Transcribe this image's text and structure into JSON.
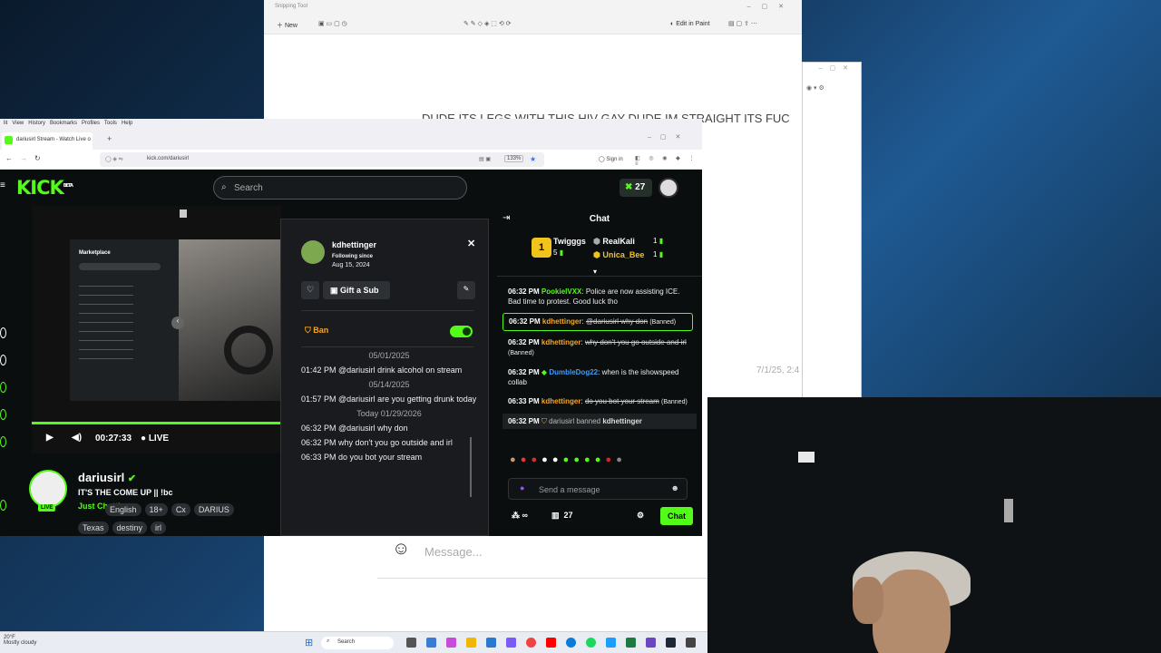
{
  "snipping": {
    "title": "Snipping Tool",
    "new_label": "New",
    "edit_in_paint": "Edit in Paint",
    "caption_text": "DUDE ITS LEGS WITH THIS HIV GAY DUDE IM STRAIGHT ITS FUC",
    "side_date": "7/1/25, 2:4"
  },
  "browser": {
    "menu": [
      "lit",
      "View",
      "History",
      "Bookmarks",
      "Profiles",
      "Tools",
      "Help"
    ],
    "tab_title": "dariusirl Stream - Watch Live o",
    "url": "kick.com/dariusirl",
    "zoom": "133%",
    "sign_in": "Sign in"
  },
  "kick": {
    "logo": "KICK",
    "logo_beta": "BETA",
    "search_placeholder": "Search",
    "kick_count": "27"
  },
  "player": {
    "time": "00:27:33",
    "live_label": "LIVE",
    "progress": 1.0
  },
  "streamer": {
    "name": "dariusirl",
    "live_badge": "LIVE",
    "title": "IT'S THE COME UP || !bc",
    "category": "Just Chatting",
    "tags_row1": [
      "English",
      "18+",
      "Cx",
      "DARIUS"
    ],
    "tags_row2": [
      "Texas",
      "destiny",
      "irl"
    ]
  },
  "user_card": {
    "username": "kdhettinger",
    "following_label": "Following since",
    "following_date": "Aug 15, 2024",
    "gift_sub": "Gift a Sub",
    "ban_label": "Ban",
    "ban_enabled": true,
    "history": [
      {
        "date": "05/01/2025",
        "messages": [
          "01:42 PM @dariusirl drink alcohol on stream"
        ]
      },
      {
        "date": "05/14/2025",
        "messages": [
          "01:57 PM @dariusirl are you getting drunk today"
        ]
      },
      {
        "date": "Today 01/29/2026",
        "messages": [
          "06:32 PM @dariusirl why don",
          "06:32 PM why don't you go outside and irl",
          "06:33 PM do you bot your stream"
        ]
      }
    ]
  },
  "chat": {
    "title": "Chat",
    "gifters": [
      {
        "rank": "1",
        "name": "Twigggs",
        "count": "5"
      },
      {
        "name": "RealKali",
        "count": "1"
      },
      {
        "name": "Unica_Bee",
        "count": "1"
      }
    ],
    "messages": [
      {
        "time": "06:32 PM",
        "user": "PookielVXX",
        "user_color": "#53fc18",
        "text": "Police are now assisting ICE. Bad time to protest. Good luck tho",
        "deleted": false,
        "banned": ""
      },
      {
        "time": "06:32 PM",
        "user": "kdhettinger",
        "user_color": "#f6a623",
        "text": "@dariusirl why don",
        "deleted": true,
        "banned": "(Banned)"
      },
      {
        "time": "06:32 PM",
        "user": "kdhettinger",
        "user_color": "#f6a623",
        "text": "why don't you go outside and irl",
        "deleted": true,
        "banned": "(Banned)"
      },
      {
        "time": "06:32 PM",
        "user": "DumbleDog22",
        "user_color": "#3b9cff",
        "text": "when is the ishowspeed collab",
        "deleted": false,
        "banned": ""
      },
      {
        "time": "06:33 PM",
        "user": "kdhettinger",
        "user_color": "#f6a623",
        "text": "do you bot your stream",
        "deleted": true,
        "banned": "(Banned)"
      }
    ],
    "ban_event": {
      "time": "06:32 PM",
      "moderator": "dariusirl",
      "action": "banned",
      "target": "kdhettinger"
    },
    "input_placeholder": "Send a message",
    "viewers": "27",
    "send_label": "Chat"
  },
  "lower_app": {
    "message_placeholder": "Message..."
  },
  "taskbar": {
    "weather_temp": "20°F",
    "weather_desc": "Mostly cloudy",
    "search_label": "Search"
  }
}
